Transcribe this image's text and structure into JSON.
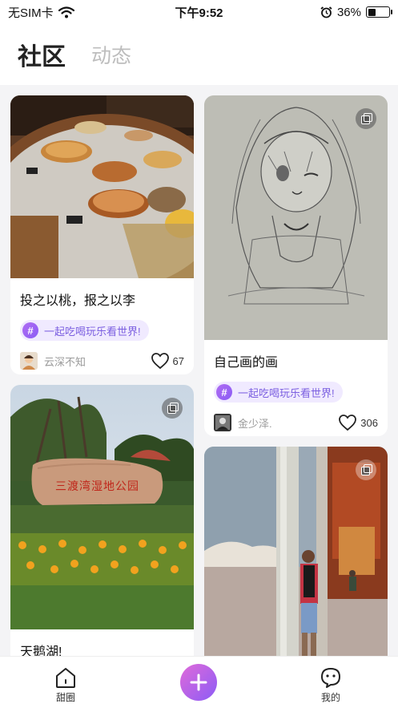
{
  "status_bar": {
    "carrier": "无SIM卡",
    "time": "下午9:52",
    "battery": "36%",
    "battery_level": 0.36
  },
  "header": {
    "tab_active": "社区",
    "tab_inactive": "动态"
  },
  "cards": [
    {
      "title": "投之以桃，报之以李",
      "topic": "一起吃喝玩乐看世界!",
      "author": "云深不知",
      "likes": "67",
      "image": "pizza-buffet-photo"
    },
    {
      "title": "自己画的画",
      "topic": "一起吃喝玩乐看世界!",
      "author": "金少泽.",
      "likes": "306",
      "image": "anime-sketch-photo"
    },
    {
      "title": "天鹅湖!",
      "image": "park-rock-sign-photo",
      "image_caption": "三渡湾湿地公园"
    },
    {
      "image": "temple-portrait-photo"
    }
  ],
  "bottom_nav": {
    "home_label": "甜圈",
    "profile_label": "我的"
  },
  "colors": {
    "accent": "#8a5cf5",
    "tag_bg": "#f0eaff",
    "add_gradient_start": "#e06ad9"
  }
}
